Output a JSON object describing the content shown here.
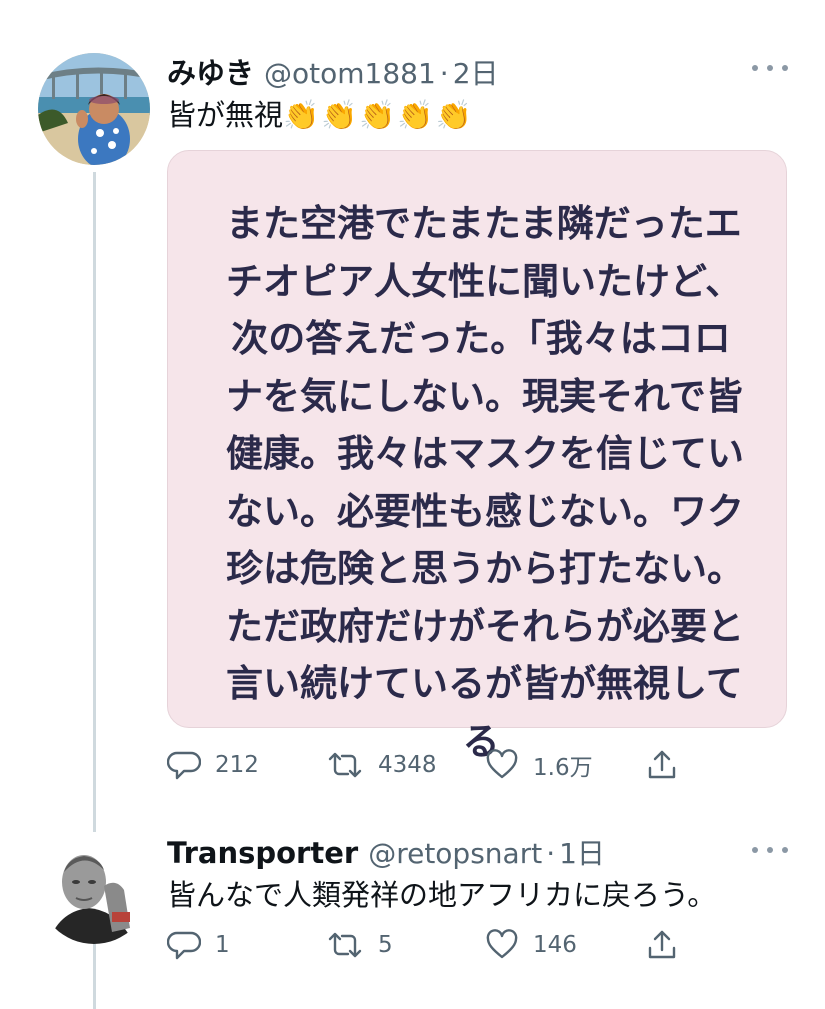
{
  "tweet1": {
    "display_name": "みゆき",
    "handle": "@otom1881",
    "separator": "·",
    "time": "2日",
    "text": "皆が無視",
    "emoji": "👏👏👏👏👏",
    "image_text": "また空港でたまたま隣だったエ\nチオピア人女性に聞いたけど、\n次の答えだった。「我々はコロ\nナを気にしない。現実それで皆\n健康。我々はマスクを信じてい\nない。必要性も感じない。ワク\n珍は危険と思うから打たない。\nただ政府だけがそれらが必要と\n言い続けているが皆が無視して\nる",
    "replies": "212",
    "retweets": "4348",
    "likes": "1.6万"
  },
  "tweet2": {
    "display_name": "Transporter",
    "handle": "@retopsnart",
    "separator": "·",
    "time": "1日",
    "text": "皆んなで人類発祥の地アフリカに戻ろう。",
    "replies": "1",
    "retweets": "5",
    "likes": "146"
  },
  "icons": {
    "reply": "comment-icon",
    "retweet": "retweet-icon",
    "like": "heart-icon",
    "share": "share-icon",
    "more": "more-icon"
  },
  "colors": {
    "text": "#0f1419",
    "secondary": "#536471",
    "thread_line": "#cfd9de",
    "image_bg": "#f6e5ea",
    "image_text": "#2b2a4a"
  }
}
